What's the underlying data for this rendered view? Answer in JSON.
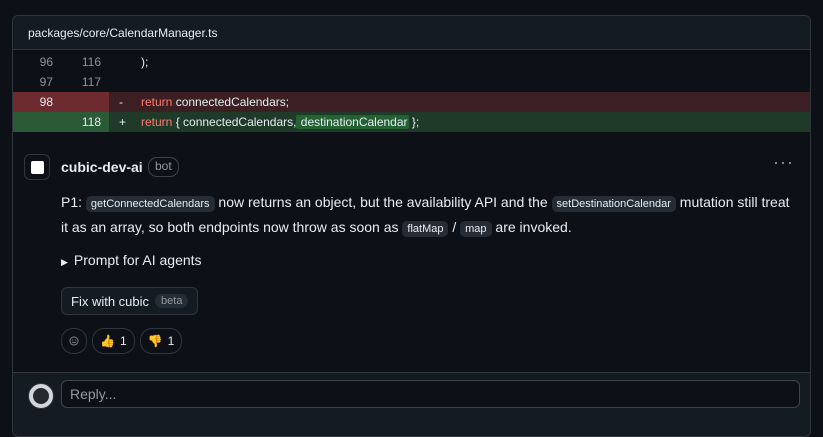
{
  "file": {
    "path": "packages/core/CalendarManager.ts"
  },
  "diff": {
    "lines": [
      {
        "old": "96",
        "new": "116",
        "marker": "",
        "code": ");"
      },
      {
        "old": "97",
        "new": "117",
        "marker": "",
        "code": ""
      },
      {
        "old": "98",
        "new": "",
        "marker": "-",
        "keyword": "return",
        "code": " connectedCalendars;"
      },
      {
        "old": "",
        "new": "118",
        "marker": "+",
        "keyword": "return",
        "code_pre": " { connectedCalendars,",
        "code_hl": " destinationCalendar",
        "code_post": " };"
      }
    ]
  },
  "comment": {
    "author": "cubic-dev-ai",
    "badge": "bot",
    "menu_icon": "···",
    "body": {
      "t1": "P1: ",
      "c1": "getConnectedCalendars",
      "t2": " now returns an object, but the availability API and the ",
      "c2": "setDestinationCalendar",
      "t3": " mutation still treat it as an array, so both endpoints now throw as soon as ",
      "c3": "flatMap",
      "t4": " / ",
      "c4": "map",
      "t5": " are invoked."
    },
    "prompt_label": "Prompt for AI agents",
    "fix_button": {
      "label": "Fix with cubic",
      "badge": "beta"
    },
    "reactions": [
      {
        "icon": "thumbs-up-icon",
        "emoji": "👍",
        "count": "1"
      },
      {
        "icon": "thumbs-down-icon",
        "emoji": "👎",
        "count": "1"
      }
    ]
  },
  "reply": {
    "placeholder": "Reply..."
  }
}
